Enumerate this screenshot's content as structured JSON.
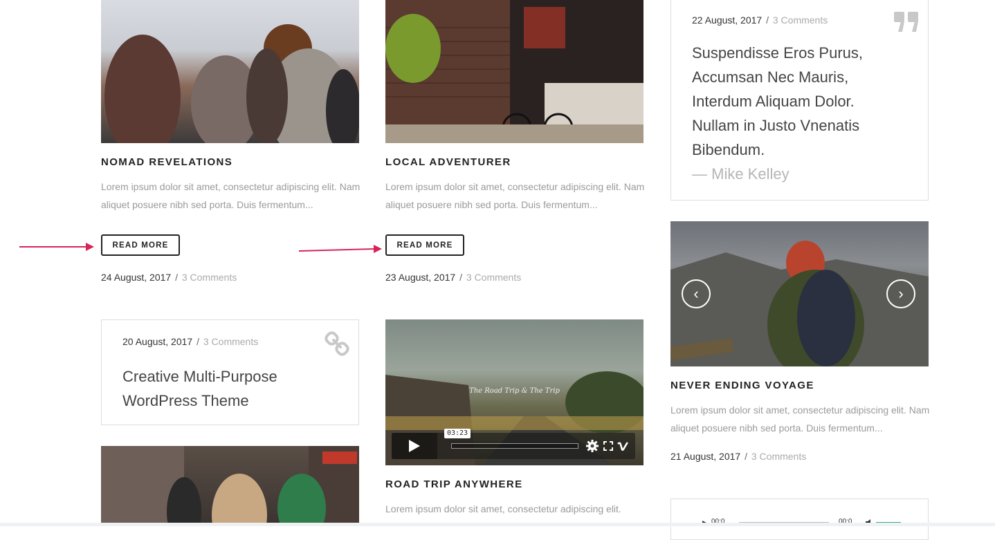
{
  "posts": [
    {
      "title": "NOMAD REVELATIONS",
      "excerpt": "Lorem ipsum dolor sit amet, consectetur adipiscing elit. Nam aliquet posuere nibh sed porta. Duis fermentum...",
      "button": "READ MORE",
      "date": "24 August, 2017",
      "separator": "/",
      "comments": "3 Comments"
    },
    {
      "title": "LOCAL ADVENTURER",
      "excerpt": "Lorem ipsum dolor sit amet, consectetur adipiscing elit. Nam aliquet posuere nibh sed porta. Duis fermentum...",
      "button": "READ MORE",
      "date": "23 August, 2017",
      "separator": "/",
      "comments": "3 Comments"
    },
    {
      "title": "NEVER ENDING VOYAGE",
      "excerpt": "Lorem ipsum dolor sit amet, consectetur adipiscing elit. Nam aliquet posuere nibh sed porta. Duis fermentum...",
      "date": "21 August, 2017",
      "separator": "/",
      "comments": "3 Comments"
    },
    {
      "title": "ROAD TRIP ANYWHERE",
      "excerpt": "Lorem ipsum dolor sit amet, consectetur adipiscing elit."
    }
  ],
  "quote_post": {
    "date": "22 August, 2017",
    "separator": "/",
    "comments": "3 Comments",
    "text": "Suspendisse Eros Purus, Accumsan Nec Mauris, Interdum Aliquam Dolor. Nullam in Justo Vnenatis Bibendum.",
    "author": "— Mike Kelley"
  },
  "link_post": {
    "date": "20 August, 2017",
    "separator": "/",
    "comments": "3 Comments",
    "title": "Creative Multi-Purpose WordPress Theme"
  },
  "video": {
    "overlay_title": "The Road Trip & The Trip",
    "time": "03:23"
  },
  "audio": {
    "time_start": "00:0",
    "time_end": "00:0"
  },
  "slider": {
    "prev": "‹",
    "next": "›"
  },
  "colors": {
    "annotation_arrow": "#d6245a",
    "accent_muted": "#aaaaaa"
  }
}
